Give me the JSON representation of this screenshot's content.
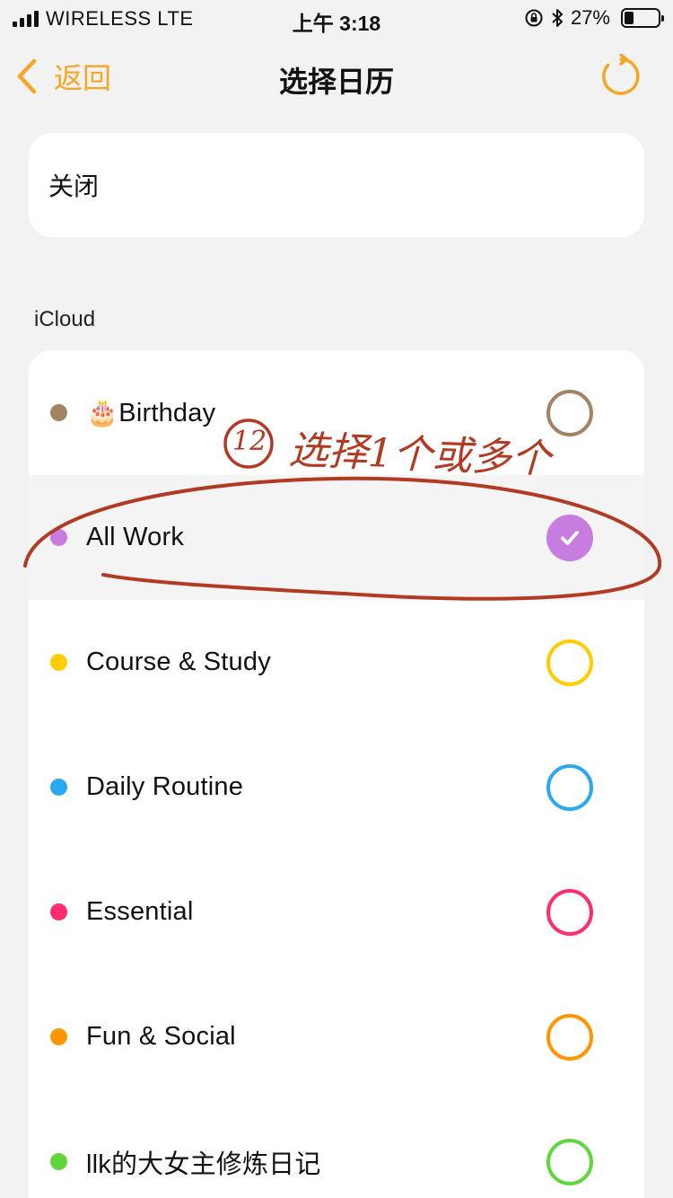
{
  "status_bar": {
    "carrier": "WIRELESS   LTE",
    "time": "上午 3:18",
    "battery": "27%",
    "battery_level": 0.27
  },
  "nav": {
    "back_label": "返回",
    "title": "选择日历",
    "accent_color": "#f5a623"
  },
  "close_card": {
    "label": "关闭"
  },
  "section": {
    "header": "iCloud"
  },
  "calendars": [
    {
      "label": "🎂Birthday",
      "color": "#a38462",
      "selected": false
    },
    {
      "label": "All Work",
      "color": "#c77de0",
      "selected": true
    },
    {
      "label": "Course & Study",
      "color": "#ffcc00",
      "selected": false
    },
    {
      "label": "Daily Routine",
      "color": "#2aa9f2",
      "selected": false
    },
    {
      "label": "Essential",
      "color": "#ff2d6e",
      "selected": false
    },
    {
      "label": "Fun & Social",
      "color": "#ff9500",
      "selected": false
    },
    {
      "label": "llk的大女主修炼日记",
      "color": "#5ed63c",
      "selected": false
    }
  ],
  "annotation": {
    "number": "12",
    "text": "选择1个或多个",
    "color": "#b23a22"
  }
}
